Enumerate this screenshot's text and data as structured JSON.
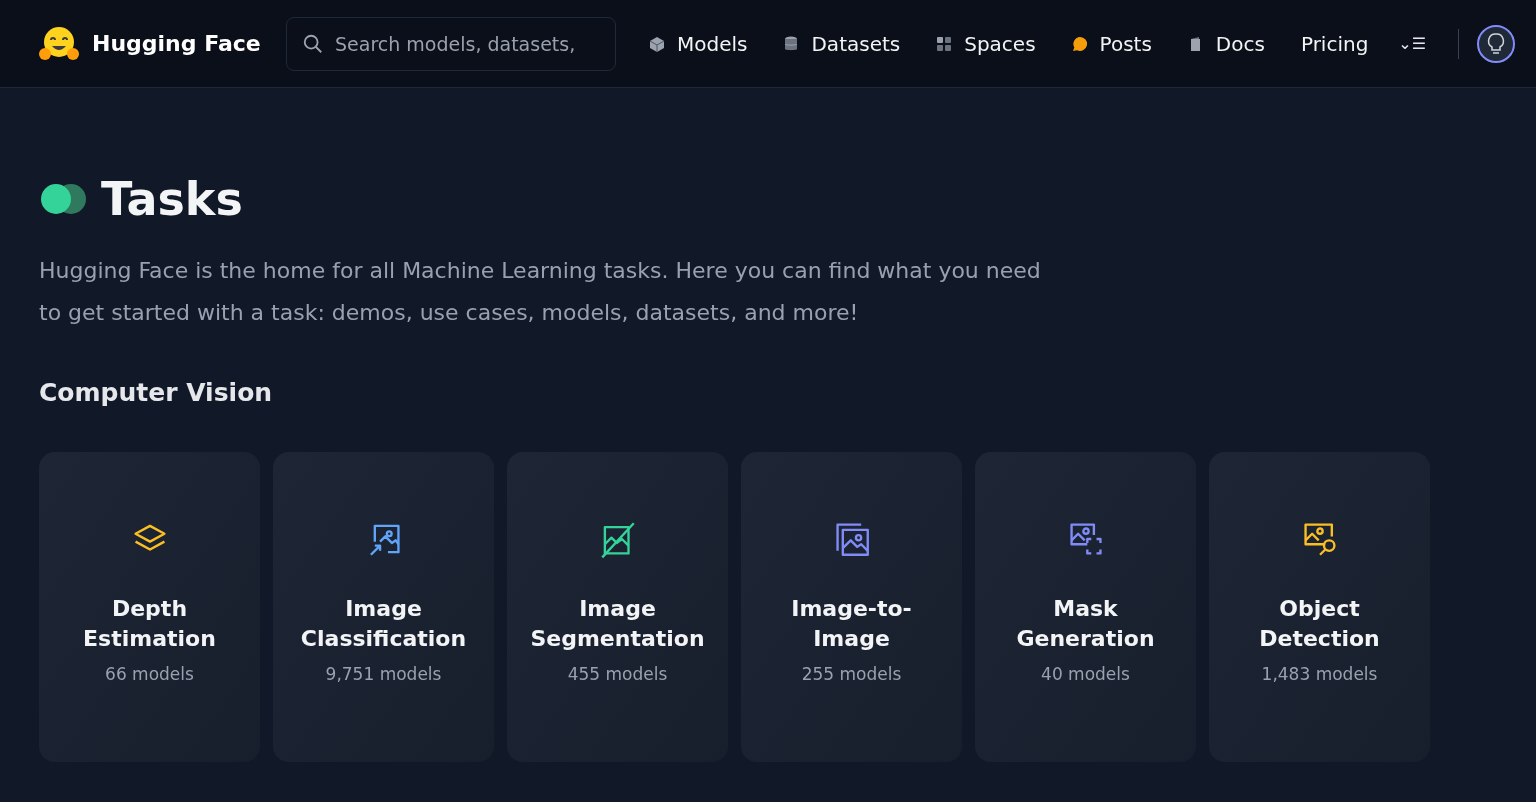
{
  "brand": {
    "name": "Hugging Face"
  },
  "search": {
    "placeholder": "Search models, datasets,"
  },
  "nav": [
    {
      "label": "Models",
      "kind": "cube"
    },
    {
      "label": "Datasets",
      "kind": "cylinder"
    },
    {
      "label": "Spaces",
      "kind": "grid"
    },
    {
      "label": "Posts",
      "kind": "bubble"
    },
    {
      "label": "Docs",
      "kind": "book"
    },
    {
      "label": "Pricing",
      "kind": "none"
    }
  ],
  "more_menu": {
    "label": "⌄☰"
  },
  "page": {
    "title": "Tasks",
    "description": "Hugging Face is the home for all Machine Learning tasks. Here you can find what you need to get started with a task: demos, use cases, models, datasets, and more!"
  },
  "section": {
    "title": "Computer Vision"
  },
  "tasks": [
    {
      "name": "Depth Estimation",
      "count": "66 models",
      "kind": "layers",
      "color": "#fbbf24"
    },
    {
      "name": "Image Classification",
      "count": "9,751 models",
      "kind": "classify",
      "color": "#60a5fa"
    },
    {
      "name": "Image Segmentation",
      "count": "455 models",
      "kind": "segment",
      "color": "#34d399"
    },
    {
      "name": "Image-to-Image",
      "count": "255 models",
      "kind": "stack",
      "color": "#818cf8"
    },
    {
      "name": "Mask Generation",
      "count": "40 models",
      "kind": "mask",
      "color": "#818cf8"
    },
    {
      "name": "Object Detection",
      "count": "1,483 models",
      "kind": "detect",
      "color": "#fbbf24"
    }
  ]
}
